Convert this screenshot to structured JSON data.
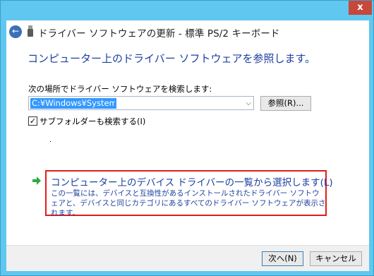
{
  "window": {
    "close_glyph": "x",
    "title": "ドライバー ソフトウェアの更新 - 標準 PS/2 キーボード"
  },
  "main": {
    "heading": "コンピューター上のドライバー ソフトウェアを参照します。",
    "search_label": "次の場所でドライバー ソフトウェアを検索します:",
    "path_value": "C:¥Windows¥System32",
    "browse_label": "参照(R)...",
    "include_subfolders_label": "サブフォルダーも検索する(I)",
    "include_subfolders_checked": true
  },
  "select_option": {
    "title": "コンピューター上のデバイス ドライバーの一覧から選択します(L)",
    "description": "この一覧には、デバイスと互換性があるインストールされたドライバー ソフトウェアと、デバイスと同じカテゴリにあるすべてのドライバー ソフトウェアが表示されます。"
  },
  "footer": {
    "next_label": "次へ(N)",
    "cancel_label": "キャンセル"
  },
  "icons": {
    "close": "close-icon",
    "back": "back-arrow-icon",
    "device": "usb-device-icon",
    "option_arrow": "green-arrow-icon",
    "combo": "chevron-down-icon"
  },
  "colors": {
    "frame": "#5fc7f0",
    "close_button": "#c7473a",
    "heading_text": "#1e3fa0",
    "option_border": "#e21b1b",
    "selection": "#3399ff",
    "arrow_green": "#2eaa3a"
  }
}
